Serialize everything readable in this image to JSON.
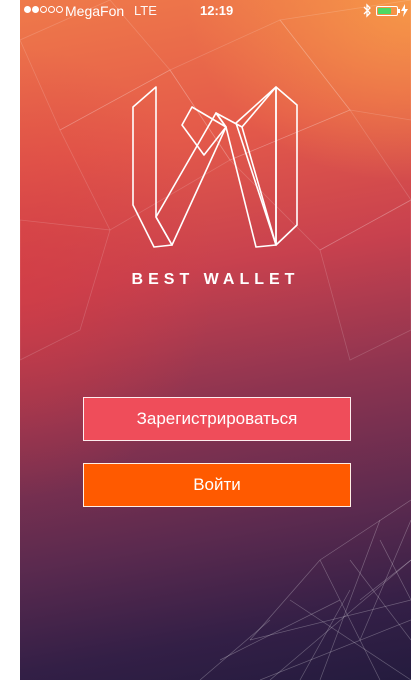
{
  "status_bar": {
    "carrier": "MegaFon",
    "network": "LTE",
    "time": "12:19",
    "signal_bars_filled": 2,
    "signal_bars_total": 5,
    "battery_level": 0.7,
    "battery_color": "#4cd964"
  },
  "brand": {
    "name": "BEST WALLET",
    "logo_icon": "w-monogram-logo-icon"
  },
  "actions": {
    "register_label": "Зарегистрироваться",
    "login_label": "Войти"
  },
  "colors": {
    "register_button": "#ef4d5a",
    "login_button": "#ff5a00",
    "text": "#ffffff"
  }
}
